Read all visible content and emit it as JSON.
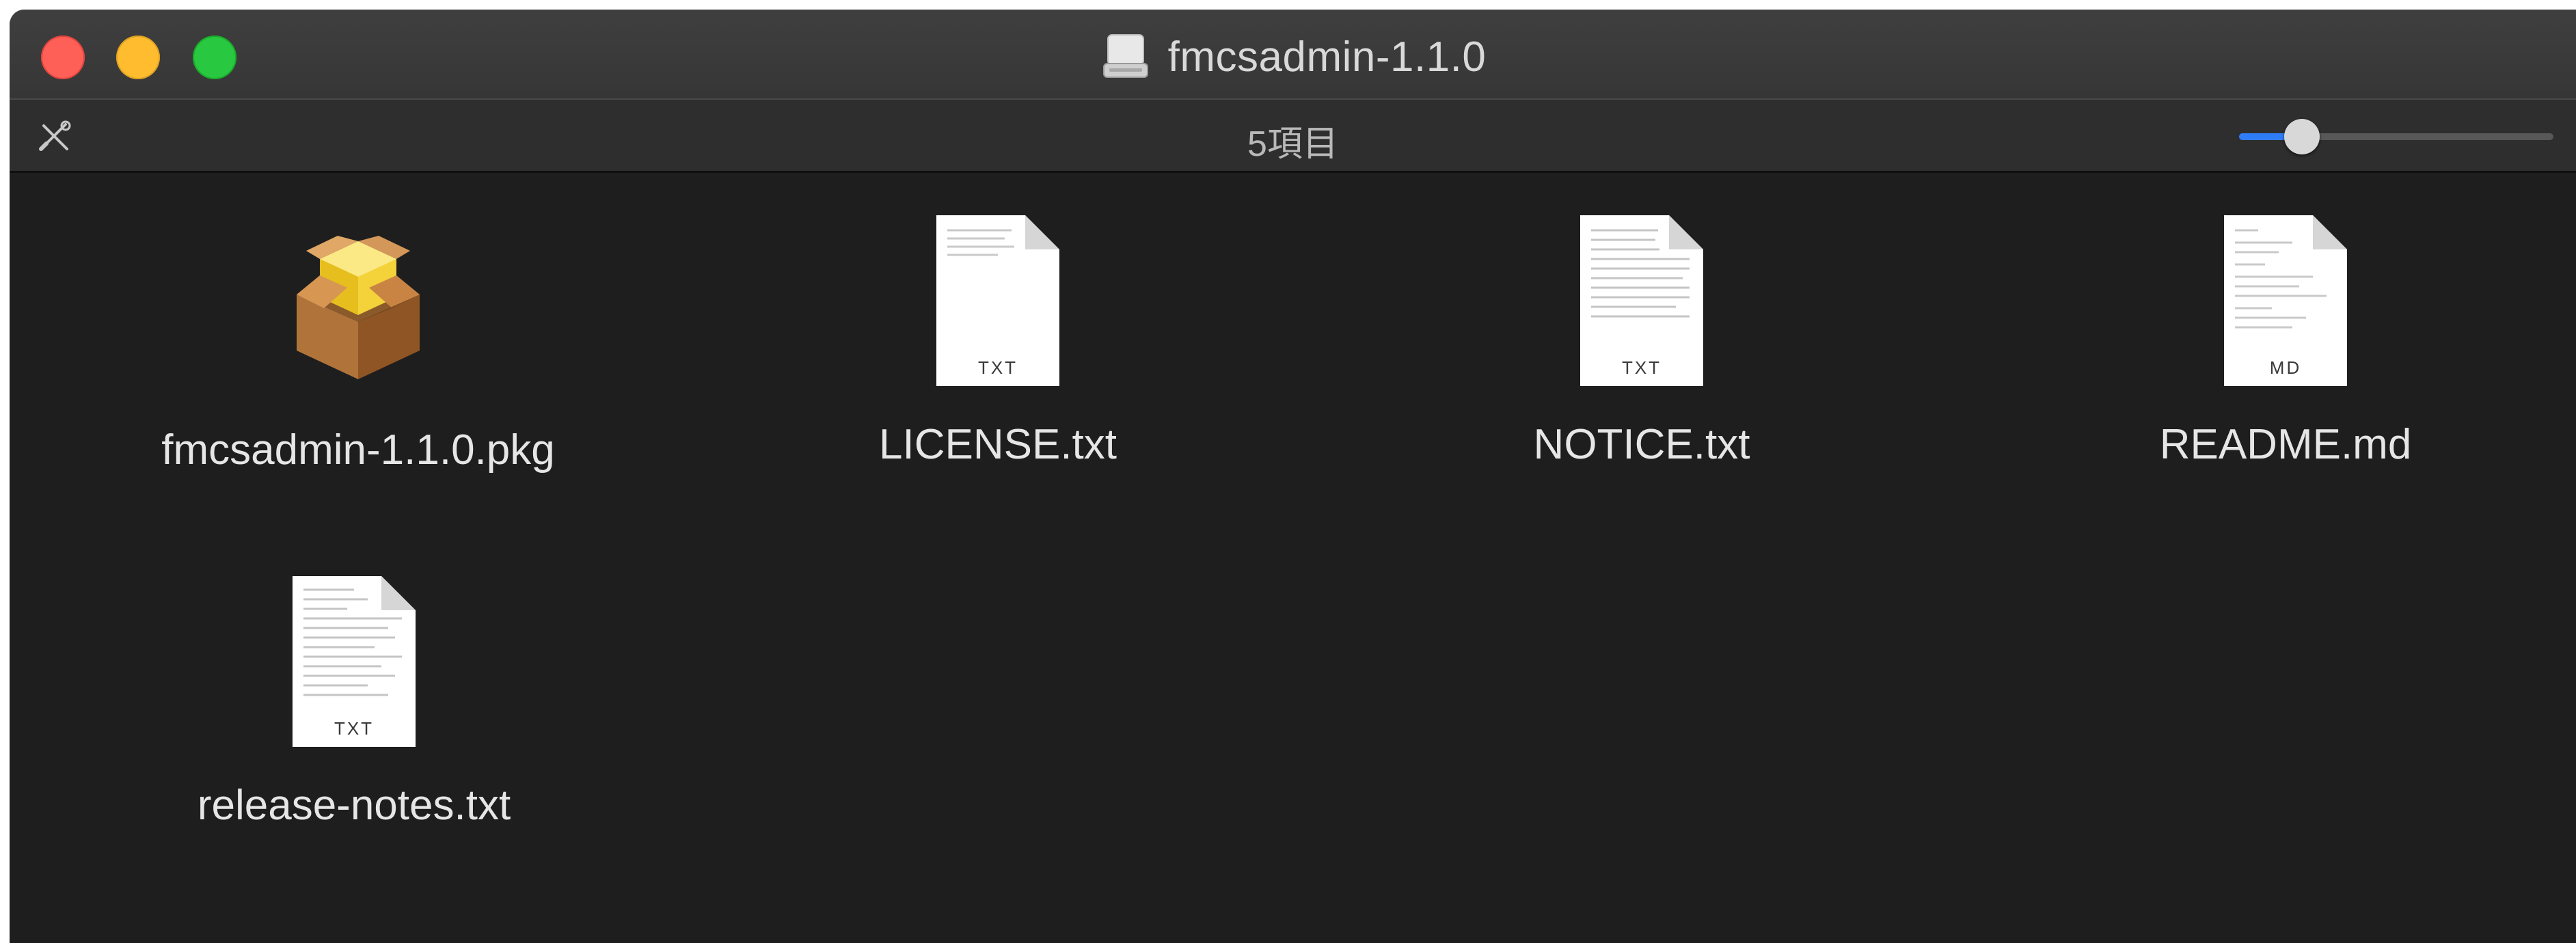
{
  "window": {
    "title": "fmcsadmin-1.1.0"
  },
  "toolbar": {
    "item_count": "5項目",
    "icon_size_level": 0.2
  },
  "files": [
    {
      "name": "fmcsadmin-1.1.0.pkg",
      "icon": "package-icon"
    },
    {
      "name": "LICENSE.txt",
      "icon": "document-icon",
      "ext": "TXT"
    },
    {
      "name": "NOTICE.txt",
      "icon": "document-icon",
      "ext": "TXT"
    },
    {
      "name": "README.md",
      "icon": "document-icon",
      "ext": "MD"
    },
    {
      "name": "release-notes.txt",
      "icon": "document-icon",
      "ext": "TXT"
    }
  ],
  "colors": {
    "close": "#fe5f57",
    "minimize": "#febc2e",
    "zoom": "#28c840",
    "accent": "#2f7df6"
  }
}
